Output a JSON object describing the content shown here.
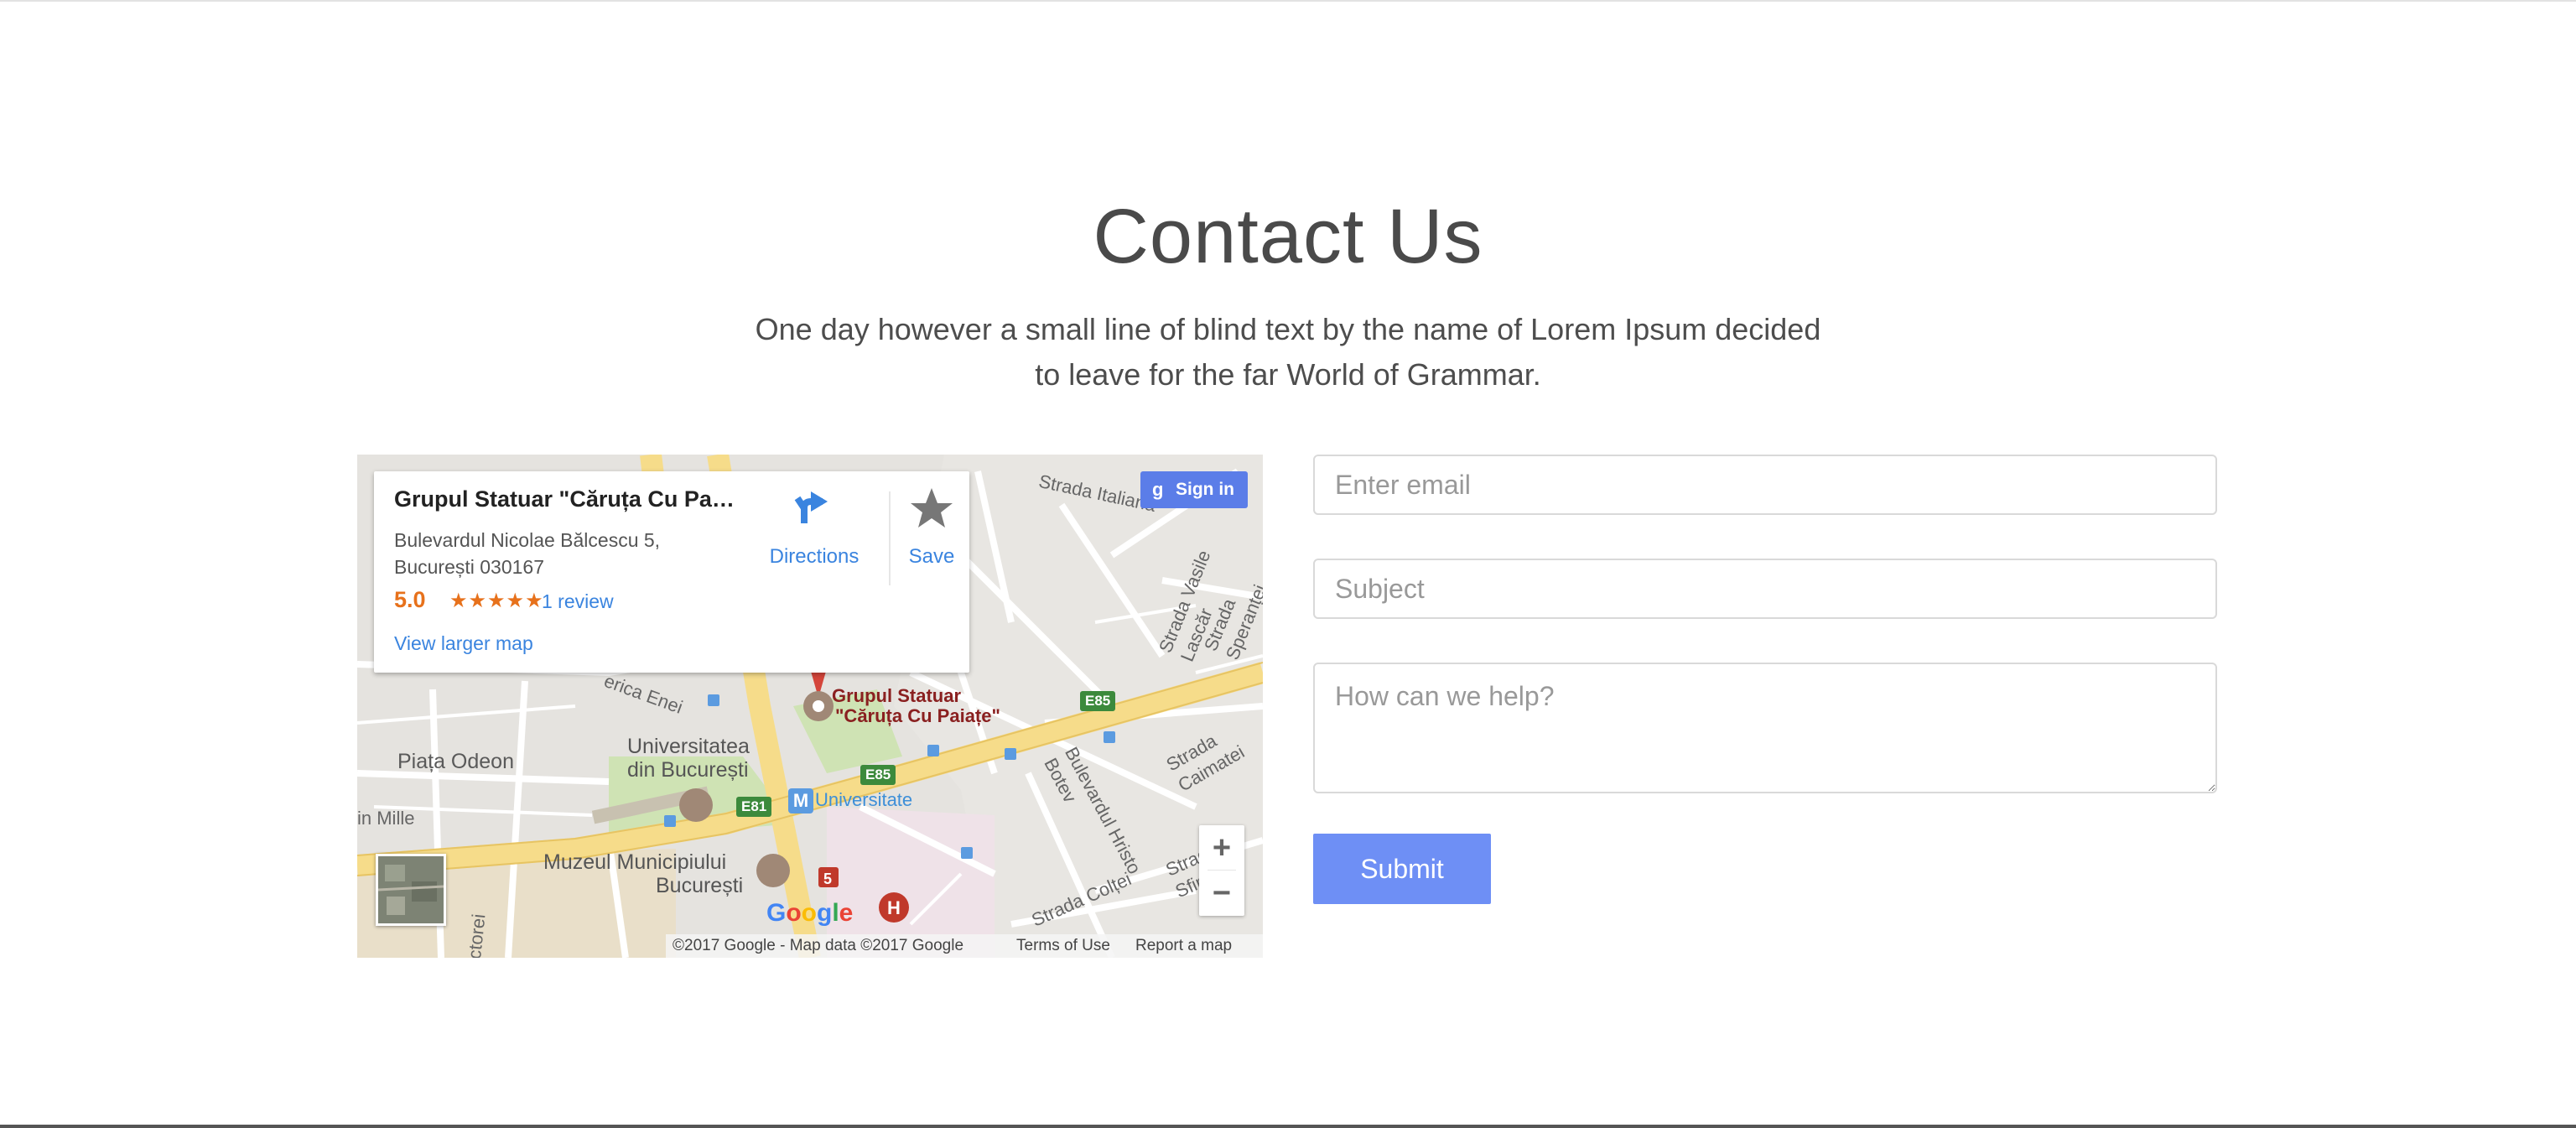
{
  "section": {
    "title": "Contact Us",
    "subtitle": "One day however a small line of blind text by the name of Lorem Ipsum decided to leave for the far World of Grammar."
  },
  "map": {
    "place_name": "Grupul Statuar \"Căruța Cu Pai…",
    "address_line1": "Bulevardul Nicolae Bălcescu 5,",
    "address_line2": "București 030167",
    "rating": "5.0",
    "stars": "★★★★★",
    "review_link": "1 review",
    "larger_map_link": "View larger map",
    "directions_label": "Directions",
    "save_label": "Save",
    "signin_label": "Sign in",
    "zoom_in": "+",
    "zoom_out": "−",
    "google_logo": "Google",
    "copyright": "©2017 Google - Map data ©2017 Google",
    "terms": "Terms of Use",
    "report": "Report a map error",
    "labels": {
      "piata_odeon": "Piața Odeon",
      "universitatea_1": "Universitatea",
      "universitatea_2": "din București",
      "universitate_metro": "Universitate",
      "muzeul_1": "Muzeul Municipiului",
      "muzeul_2": "București",
      "marker_1": "Grupul Statuar",
      "marker_2": "\"Căruța Cu Paiațe\"",
      "strada_italiana": "Strada Italiană",
      "strada_vasile": "Strada Vasile Lascăr",
      "strada_sperantei": "Strada Speranței",
      "strada_caimatei": "Strada Caimatei",
      "bulevardul_hristo": "Bulevardul Hristo Botev",
      "strada_sfintii": "Strada Sfinții",
      "strada_coltei": "Strada Colței",
      "in_mille": "in Mille",
      "ctorei": "ctorei",
      "america": "erica Enei",
      "e85_a": "E85",
      "e85_b": "E85",
      "e81": "E81",
      "five": "5"
    },
    "colors": {
      "marker": "#d4453a",
      "primary_road": "#f6dc8a",
      "park": "#cfe3b4"
    }
  },
  "form": {
    "email_placeholder": "Enter email",
    "subject_placeholder": "Subject",
    "message_placeholder": "How can we help?",
    "submit_label": "Submit"
  },
  "colors": {
    "accent": "#6e8ff5",
    "link": "#3a84df"
  }
}
